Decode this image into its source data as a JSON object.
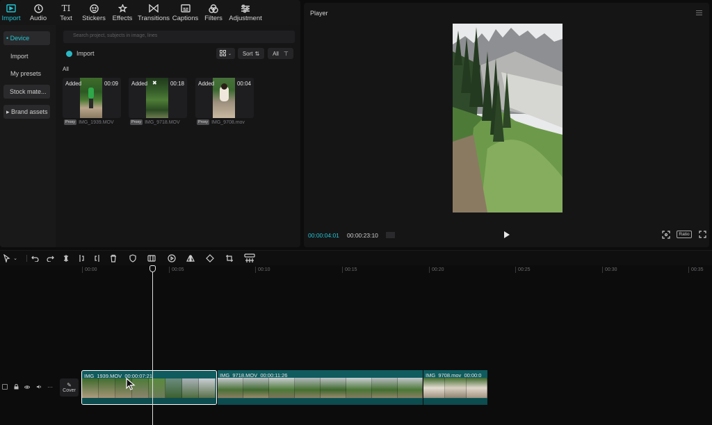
{
  "topnav": {
    "tabs": [
      {
        "label": "Import",
        "icon": "import-icon",
        "active": true
      },
      {
        "label": "Audio",
        "icon": "audio-icon"
      },
      {
        "label": "Text",
        "icon": "text-icon"
      },
      {
        "label": "Stickers",
        "icon": "stickers-icon"
      },
      {
        "label": "Effects",
        "icon": "effects-icon"
      },
      {
        "label": "Transitions",
        "icon": "transitions-icon"
      },
      {
        "label": "Captions",
        "icon": "captions-icon"
      },
      {
        "label": "Filters",
        "icon": "filters-icon"
      },
      {
        "label": "Adjustment",
        "icon": "adjustment-icon"
      }
    ]
  },
  "sidebar": {
    "items": [
      {
        "label": "• Device"
      },
      {
        "label": "Import"
      },
      {
        "label": "My presets"
      },
      {
        "label": "Stock mate..."
      },
      {
        "label": "▸ Brand assets"
      }
    ]
  },
  "media": {
    "search_placeholder": "Search project, subjects in image, lines",
    "import_label": "Import",
    "sort_label": "Sort",
    "filter_all_label": "All",
    "section_label": "All",
    "items": [
      {
        "status": "Added",
        "duration": "00:09",
        "badge": "Proxy",
        "name": "IMG_1939.MOV"
      },
      {
        "status": "Added",
        "duration": "00:18",
        "badge": "Proxy",
        "name": "IMG_9718.MOV"
      },
      {
        "status": "Added",
        "duration": "00:04",
        "badge": "Proxy",
        "name": "IMG_9708.mov"
      }
    ]
  },
  "player": {
    "title": "Player",
    "current_time": "00:00:04:01",
    "total_time": "00:00:23:10",
    "ratio_label": "Ratio"
  },
  "ruler": {
    "ticks": [
      "00:00",
      "00:05",
      "00:10",
      "00:15",
      "00:20",
      "00:25",
      "00:30",
      "00:35"
    ]
  },
  "timeline": {
    "cover_label": "Cover",
    "clips": [
      {
        "name": "IMG_1939.MOV",
        "duration": "00:00:07:21"
      },
      {
        "name": "IMG_9718.MOV",
        "duration": "00:00:11:26"
      },
      {
        "name": "IMG_9708.mov",
        "duration": "00:00:0"
      }
    ]
  },
  "colors": {
    "accent": "#21c4d2",
    "clip": "#0f5b5e",
    "panel": "#151516"
  }
}
